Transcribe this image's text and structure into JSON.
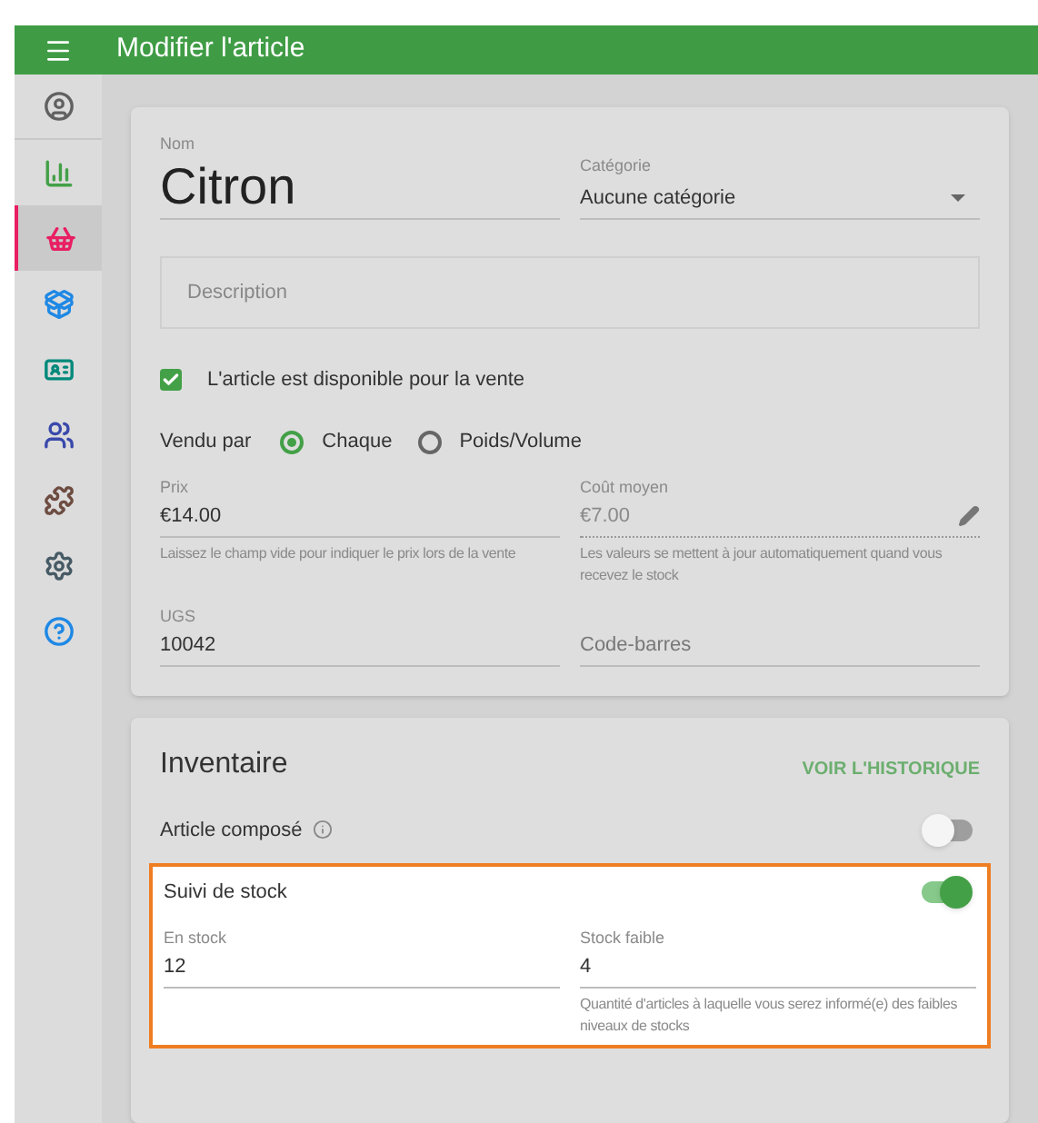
{
  "app_bar": {
    "title": "Modifier l'article"
  },
  "sidebar": {
    "items": [
      {
        "selected": false,
        "color": "#616161"
      },
      {
        "selected": false,
        "color": "#43a047"
      },
      {
        "selected": true,
        "color": "#e91e63"
      },
      {
        "selected": false,
        "color": "#1e88e5"
      },
      {
        "selected": false,
        "color": "#00897b"
      },
      {
        "selected": false,
        "color": "#3949ab"
      },
      {
        "selected": false,
        "color": "#6d4c41"
      },
      {
        "selected": false,
        "color": "#455a64"
      },
      {
        "selected": false,
        "color": "#1e88e5"
      }
    ]
  },
  "item_card": {
    "name": {
      "label": "Nom",
      "value": "Citron"
    },
    "category": {
      "label": "Catégorie",
      "value": "Aucune catégorie"
    },
    "description": {
      "placeholder": "Description"
    },
    "available": {
      "label": "L'article est disponible pour la vente",
      "checked": true
    },
    "sold_by": {
      "label": "Vendu par",
      "options": [
        {
          "label": "Chaque",
          "selected": true
        },
        {
          "label": "Poids/Volume",
          "selected": false
        }
      ]
    },
    "price": {
      "label": "Prix",
      "value": "€14.00",
      "hint": "Laissez le champ vide pour indiquer le prix lors de la vente"
    },
    "cost": {
      "label": "Coût moyen",
      "value": "€7.00",
      "hint": "Les valeurs se mettent à jour automatiquement quand vous recevez le stock"
    },
    "sku": {
      "label": "UGS",
      "value": "10042"
    },
    "barcode": {
      "placeholder": "Code-barres"
    }
  },
  "inventory_card": {
    "title": "Inventaire",
    "history_link": "VOIR L'HISTORIQUE",
    "composite": {
      "label": "Article composé",
      "on": false
    },
    "tracking": {
      "label": "Suivi de stock",
      "on": true
    },
    "in_stock": {
      "label": "En stock",
      "value": "12"
    },
    "low_stock": {
      "label": "Stock faible",
      "value": "4",
      "hint": "Quantité d'articles à laquelle vous serez informé(e) des faibles niveaux de stocks"
    }
  }
}
